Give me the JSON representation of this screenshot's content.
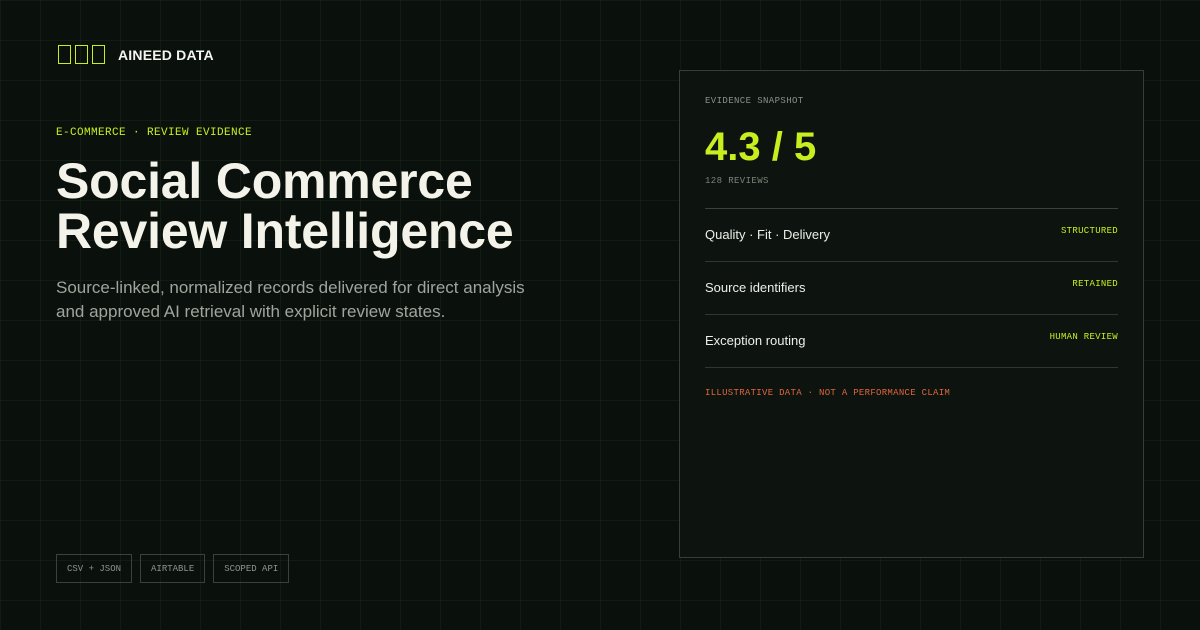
{
  "brand": {
    "logo_icon": "three-box-logo",
    "name": "AINEED DATA"
  },
  "hero": {
    "eyebrow": "E-COMMERCE · REVIEW EVIDENCE",
    "title_line1": "Social Commerce",
    "title_line2": "Review Intelligence",
    "description": "Source-linked, normalized records delivered for direct analysis and approved AI retrieval with explicit review states."
  },
  "chips": [
    "CSV + JSON",
    "AIRTABLE",
    "SCOPED API"
  ],
  "card": {
    "label": "EVIDENCE SNAPSHOT",
    "score": "4.3 / 5",
    "review_count": "128 REVIEWS",
    "rows": [
      {
        "label": "Quality · Fit · Delivery",
        "status": "STRUCTURED"
      },
      {
        "label": "Source identifiers",
        "status": "RETAINED"
      },
      {
        "label": "Exception routing",
        "status": "HUMAN REVIEW"
      }
    ],
    "disclaimer": "ILLUSTRATIVE DATA · NOT A PERFORMANCE CLAIM"
  },
  "colors": {
    "accent": "#c8ee1f",
    "warning": "#e0643c",
    "background": "#0a110d"
  }
}
